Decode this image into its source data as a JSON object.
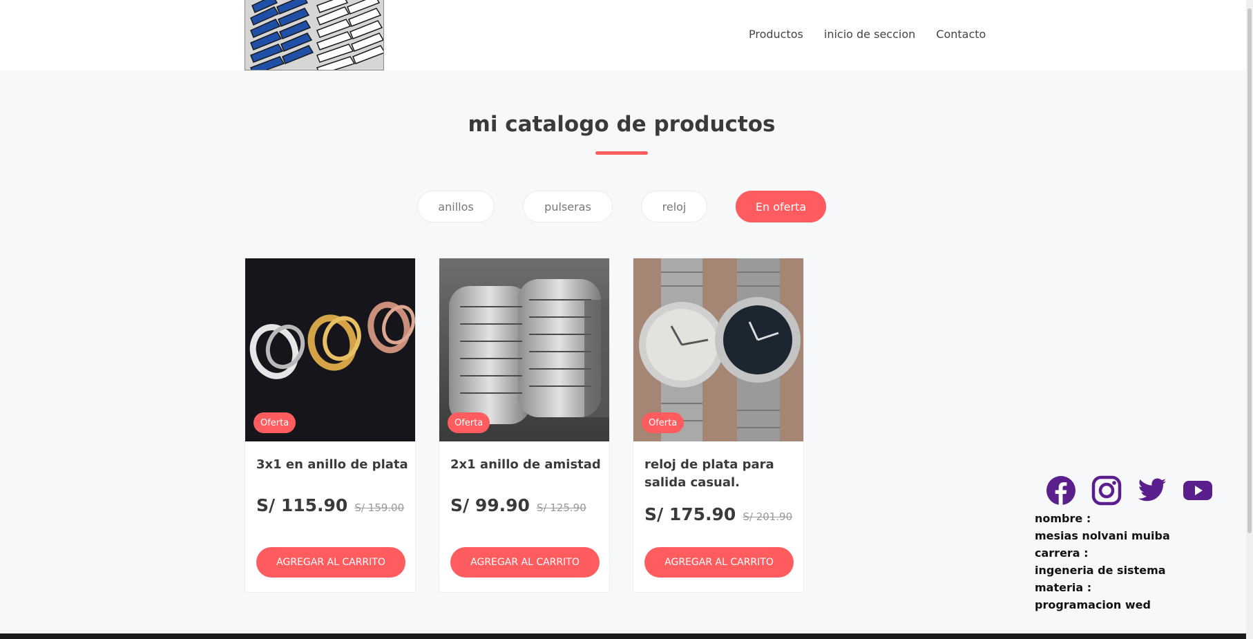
{
  "nav": {
    "items": [
      "Productos",
      "inicio de seccion",
      "Contacto"
    ]
  },
  "catalog": {
    "title": "mi catalogo de productos"
  },
  "filters": [
    {
      "label": "anillos",
      "active": false
    },
    {
      "label": "pulseras",
      "active": false
    },
    {
      "label": "reloj",
      "active": false
    },
    {
      "label": "En oferta",
      "active": true
    }
  ],
  "products": [
    {
      "badge": "Oferta",
      "name": "3x1 en anillo de plata",
      "price": "S/ 115.90",
      "old_price": "S/ 159.00",
      "button": "AGREGAR AL CARRITO"
    },
    {
      "badge": "Oferta",
      "name": "2x1 anillo de amistad",
      "price": "S/ 99.90",
      "old_price": "S/ 125.90",
      "button": "AGREGAR AL CARRITO"
    },
    {
      "badge": "Oferta",
      "name": "reloj de plata para salida casual.",
      "price": "S/ 175.90",
      "old_price": "S/ 201.90",
      "button": "AGREGAR AL CARRITO"
    }
  ],
  "social": [
    "facebook-icon",
    "instagram-icon",
    "twitter-icon",
    "youtube-icon"
  ],
  "colors": {
    "accent": "#ff5c5f",
    "social": "#5a1f8c"
  },
  "info": {
    "nombre_label": "nombre :",
    "nombre": "mesias nolvani muiba",
    "carrera_label": "carrera :",
    "carrera": "ingeneria de sistema",
    "materia_label": "materia :",
    "materia": "programacion wed"
  }
}
